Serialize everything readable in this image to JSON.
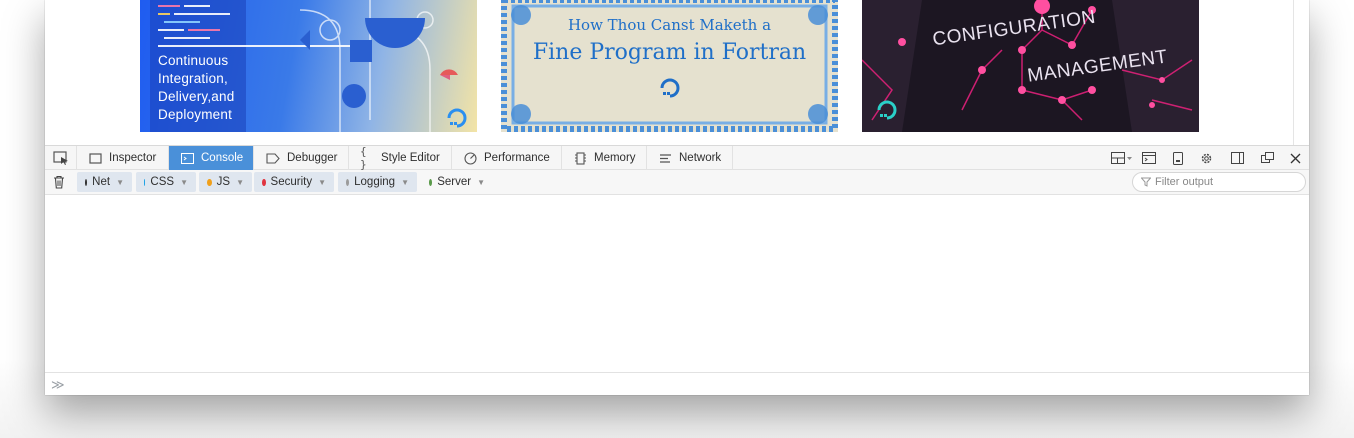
{
  "page": {
    "thumbnails": [
      {
        "lines": [
          "Continuous",
          "Integration,",
          "Delivery,and",
          "Deployment"
        ]
      },
      {
        "title_line1": "How Thou Canst Maketh a",
        "title_line2": "Fine Program in Fortran"
      },
      {
        "title_line1": "CONFIGURATION",
        "title_line2": "MANAGEMENT"
      }
    ]
  },
  "toolbar": {
    "tabs": [
      {
        "label": "Inspector",
        "icon": "inspector-icon"
      },
      {
        "label": "Console",
        "icon": "console-icon",
        "selected": true
      },
      {
        "label": "Debugger",
        "icon": "debugger-icon"
      },
      {
        "label": "Style Editor",
        "icon": "braces-icon"
      },
      {
        "label": "Performance",
        "icon": "performance-icon"
      },
      {
        "label": "Memory",
        "icon": "memory-icon"
      },
      {
        "label": "Network",
        "icon": "network-icon"
      }
    ],
    "accent": "#4a90d9"
  },
  "filters": {
    "items": [
      {
        "label": "Net",
        "color": "#333333"
      },
      {
        "label": "CSS",
        "color": "#1fa3e6"
      },
      {
        "label": "JS",
        "color": "#f0a01b"
      },
      {
        "label": "Security",
        "color": "#e0343f"
      },
      {
        "label": "Logging",
        "color": "#9b9b9b"
      },
      {
        "label": "Server",
        "color": "#5a9a4a"
      }
    ],
    "filter_placeholder": "Filter output"
  },
  "console": {
    "prompt": "≫"
  }
}
